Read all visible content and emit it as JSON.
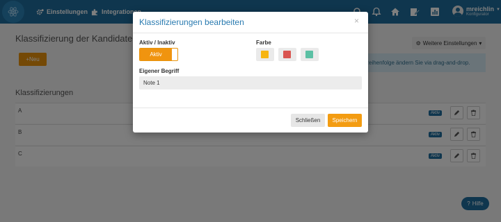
{
  "topbar": {
    "nav": [
      {
        "label": "Einstellungen",
        "icon": "gears-icon"
      },
      {
        "label": "Integrationen",
        "icon": "puzzle-icon"
      }
    ],
    "icons": [
      "search-icon",
      "bell-icon",
      "home-icon",
      "edit-icon",
      "chart-icon"
    ],
    "user": {
      "name": "mreichlin",
      "role": "Konfigurator"
    }
  },
  "page": {
    "title": "Klassifizierung der Kandidaten verwalten",
    "new_button": "Neu",
    "more_settings": "Weitere Einstellungen",
    "info_text": "Die Reihenfolge ändern Sie via drag-and-drop.",
    "section_title": "Klassifizierungen",
    "rows": [
      {
        "label": "A",
        "status": "Aktiv"
      },
      {
        "label": "B",
        "status": "Aktiv"
      },
      {
        "label": "C",
        "status": "Aktiv"
      }
    ],
    "help_button": "Hilfe"
  },
  "modal": {
    "title": "Klassifizierungen bearbeiten",
    "close_symbol": "×",
    "active_label": "Aktiv / Inaktiv",
    "toggle_text": "Aktiv",
    "color_label": "Farbe",
    "colors": [
      "#f7b512",
      "#d9534f",
      "#5bc0a4"
    ],
    "term_label": "Eigener Begriff",
    "term_value": "Note 1",
    "close_button": "Schließen",
    "save_button": "Speichern"
  },
  "colors": {
    "primary": "#1f6d9c",
    "accent": "#f39c12"
  }
}
